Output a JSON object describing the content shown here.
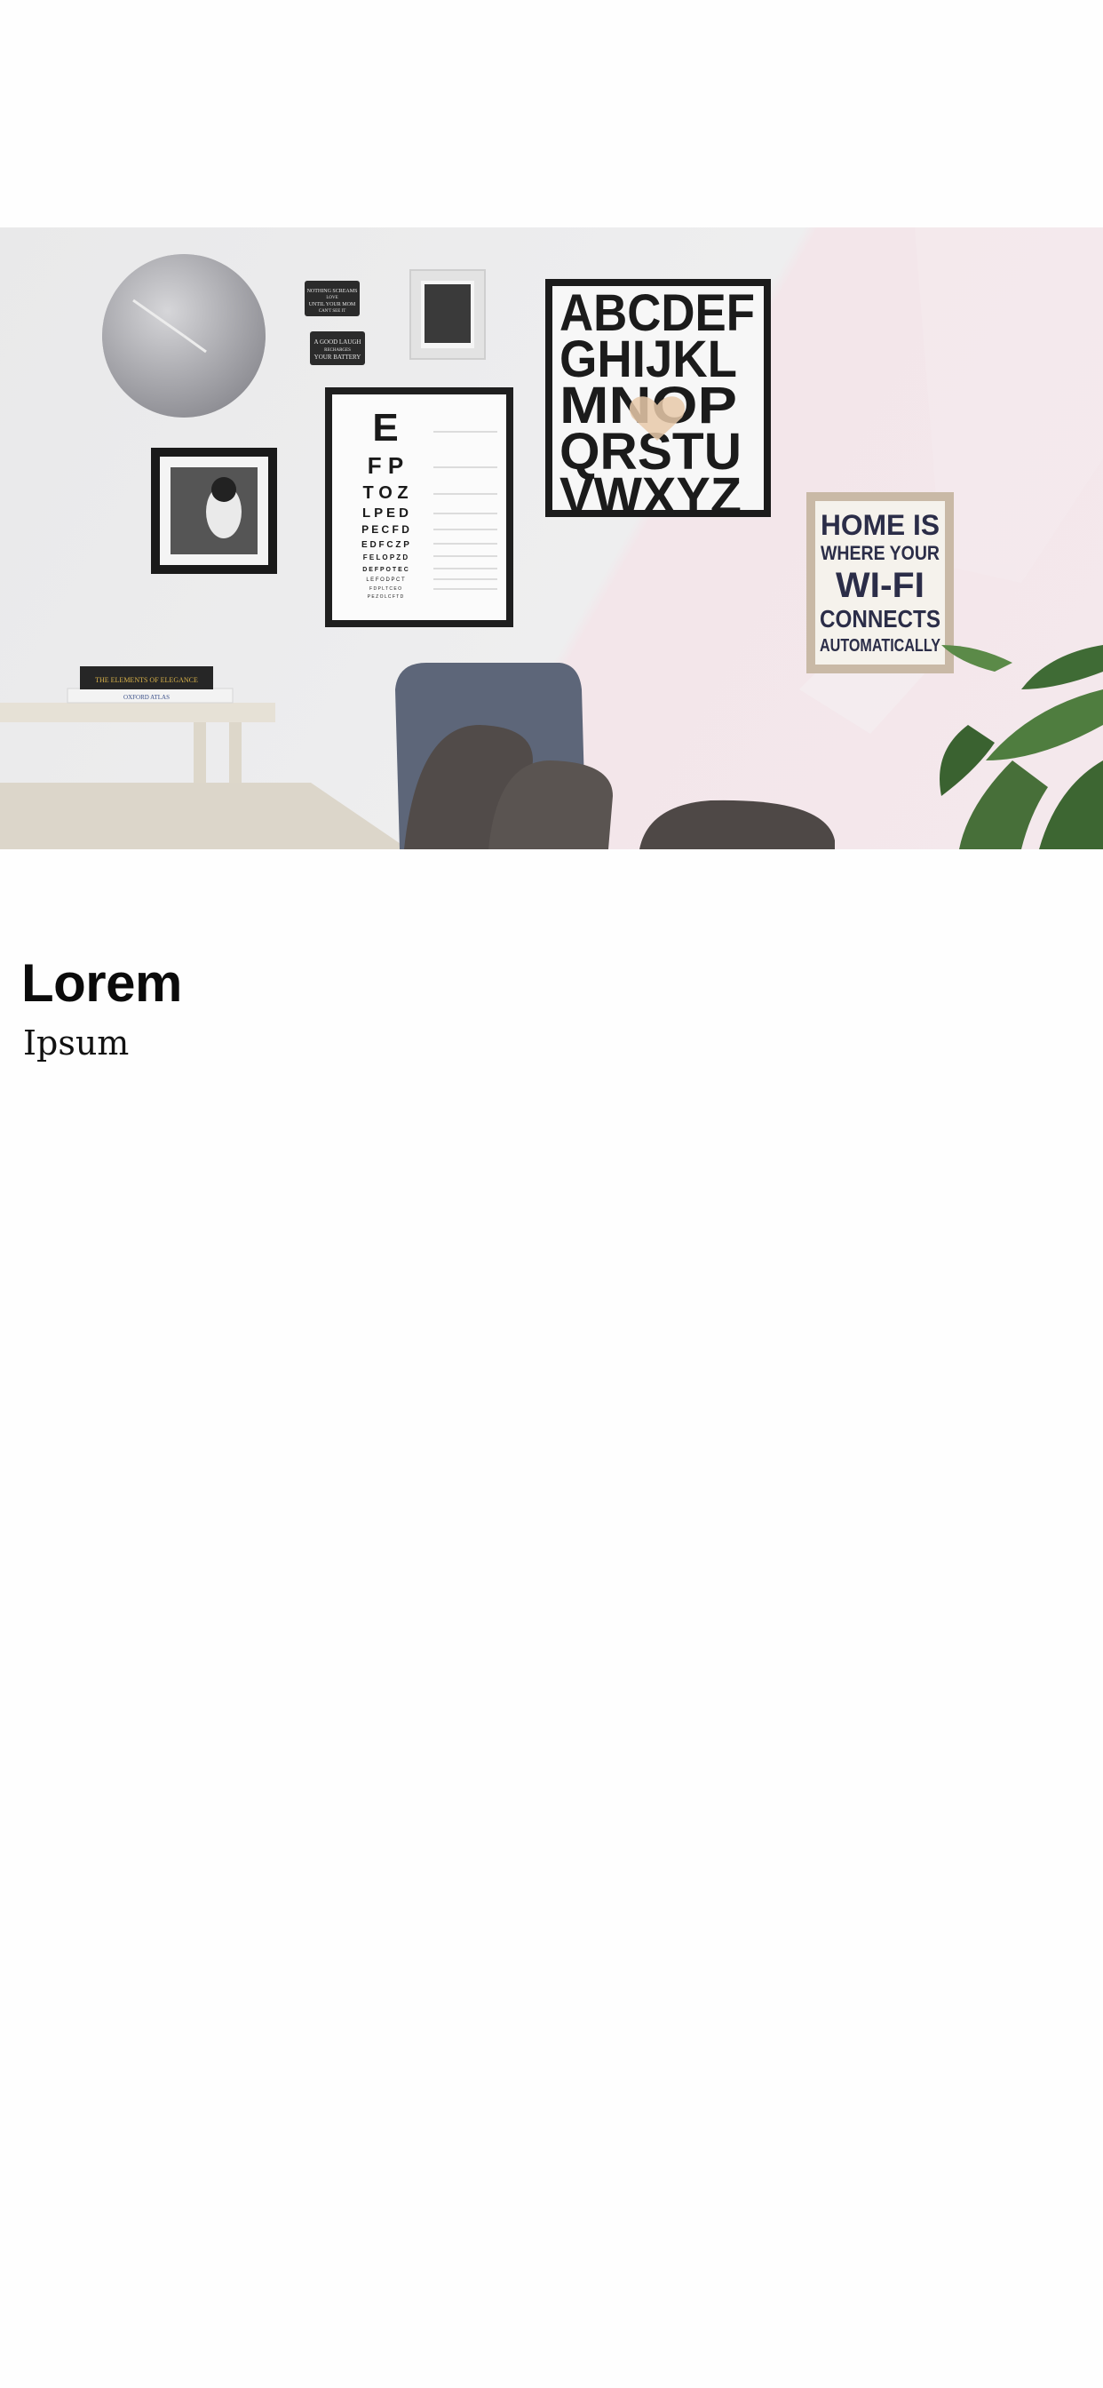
{
  "hero": {
    "alphabet_poster_text": [
      "ABCDEF",
      "GHIJKL",
      "MNOP",
      "QRSTU",
      "VWXYZ"
    ],
    "wifi_poster_text": [
      "HOME IS",
      "WHERE YOUR",
      "WI-FI",
      "CONNECTS",
      "AUTOMATICALLY"
    ],
    "sign_top_text": [
      "NOTHING SCREAMS",
      "LOVE",
      "UNTIL YOUR MOM",
      "CAN'T SEE IT"
    ],
    "sign_bottom_text": [
      "A GOOD LAUGH",
      "RECHARGES",
      "YOUR BATTERY"
    ],
    "eye_chart_rows": [
      "E",
      "F P",
      "T O Z",
      "L P E D",
      "P E C F D",
      "E D F C Z P",
      "F E L O P Z D",
      "D E F P O T E C",
      "L E F O D P C T",
      "F D P L T C E O",
      "P E Z O L C F T D"
    ],
    "book_titles": [
      "THE ELEMENTS OF ELEGANCE",
      "OXFORD ATLAS"
    ]
  },
  "content": {
    "title": "Lorem",
    "subtitle": "Ipsum"
  },
  "colors": {
    "background": "#fefefe",
    "title": "#0b0b0b",
    "wall_left": "#e9e9ea",
    "wall_pink": "#f4e8ec",
    "frame_black": "#1a1a1a",
    "chair_gray": "#5d6679"
  }
}
